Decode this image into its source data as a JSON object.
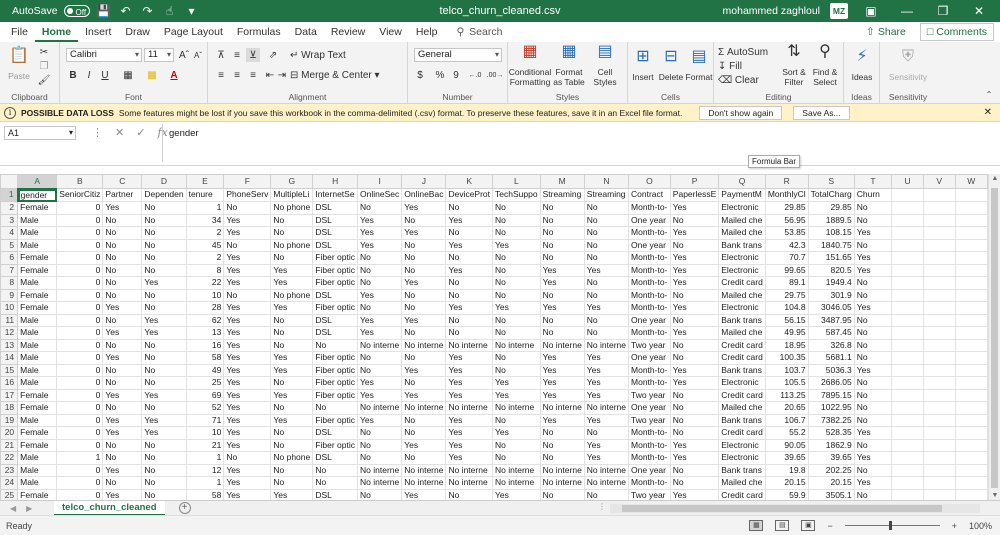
{
  "titlebar": {
    "autosave_label": "AutoSave",
    "autosave_state": "Off",
    "filename": "telco_churn_cleaned.csv",
    "user": "mohammed zaghloul",
    "avatar_initials": "MZ",
    "accent": "#217346"
  },
  "tabs": [
    "File",
    "Home",
    "Insert",
    "Draw",
    "Page Layout",
    "Formulas",
    "Data",
    "Review",
    "View",
    "Help"
  ],
  "active_tab": "Home",
  "search_label": "Search",
  "share_label": "Share",
  "comments_label": "Comments",
  "ribbon": {
    "clipboard": {
      "paste": "Paste",
      "label": "Clipboard"
    },
    "font": {
      "name": "Calibri",
      "size": "11",
      "label": "Font",
      "bold": "B",
      "italic": "I",
      "underline": "U"
    },
    "alignment": {
      "wrap": "Wrap Text",
      "merge": "Merge & Center",
      "label": "Alignment"
    },
    "number": {
      "format": "General",
      "currency": "$",
      "percent": "%",
      "comma": "9",
      "label": "Number"
    },
    "styles": {
      "conditional": "Conditional Formatting",
      "table": "Format as Table",
      "cell": "Cell Styles",
      "label": "Styles"
    },
    "cells": {
      "insert": "Insert",
      "delete": "Delete",
      "format": "Format",
      "label": "Cells"
    },
    "editing": {
      "autosum": "AutoSum",
      "fill": "Fill",
      "clear": "Clear",
      "sort": "Sort & Filter",
      "find": "Find & Select",
      "label": "Editing"
    },
    "ideas": {
      "ideas": "Ideas",
      "label": "Ideas"
    },
    "sensitivity": {
      "sensitivity": "Sensitivity",
      "label": "Sensitivity"
    }
  },
  "infobar": {
    "title": "POSSIBLE DATA LOSS",
    "message": "Some features might be lost if you save this workbook in the comma-delimited (.csv) format. To preserve these features, save it in an Excel file format.",
    "dont_show": "Don't show again",
    "save_as": "Save As..."
  },
  "formula_bar": {
    "name_box": "A1",
    "formula": "gender",
    "tooltip": "Formula Bar"
  },
  "columns": [
    "A",
    "B",
    "C",
    "D",
    "E",
    "F",
    "G",
    "H",
    "I",
    "J",
    "K",
    "L",
    "M",
    "N",
    "O",
    "P",
    "Q",
    "R",
    "S",
    "T",
    "U",
    "V",
    "W"
  ],
  "numeric_columns": [
    1,
    4,
    17,
    18
  ],
  "rows": [
    [
      "gender",
      "SeniorCitiz",
      "Partner",
      "Dependen",
      "tenure",
      "PhoneServ",
      "MultipleLi",
      "InternetSe",
      "OnlineSec",
      "OnlineBac",
      "DeviceProt",
      "TechSuppo",
      "Streaming",
      "Streaming",
      "Contract",
      "PaperlessE",
      "PaymentM",
      "MonthlyCl",
      "TotalCharg",
      "Churn"
    ],
    [
      "Female",
      "0",
      "Yes",
      "No",
      "1",
      "No",
      "No phone",
      "DSL",
      "No",
      "Yes",
      "No",
      "No",
      "No",
      "No",
      "Month-to-",
      "Yes",
      "Electronic",
      "29.85",
      "29.85",
      "No"
    ],
    [
      "Male",
      "0",
      "No",
      "No",
      "34",
      "Yes",
      "No",
      "DSL",
      "Yes",
      "No",
      "Yes",
      "No",
      "No",
      "No",
      "One year",
      "No",
      "Mailed che",
      "56.95",
      "1889.5",
      "No"
    ],
    [
      "Male",
      "0",
      "No",
      "No",
      "2",
      "Yes",
      "No",
      "DSL",
      "Yes",
      "Yes",
      "No",
      "No",
      "No",
      "No",
      "Month-to-",
      "Yes",
      "Mailed che",
      "53.85",
      "108.15",
      "Yes"
    ],
    [
      "Male",
      "0",
      "No",
      "No",
      "45",
      "No",
      "No phone",
      "DSL",
      "Yes",
      "No",
      "Yes",
      "Yes",
      "No",
      "No",
      "One year",
      "No",
      "Bank trans",
      "42.3",
      "1840.75",
      "No"
    ],
    [
      "Female",
      "0",
      "No",
      "No",
      "2",
      "Yes",
      "No",
      "Fiber optic",
      "No",
      "No",
      "No",
      "No",
      "No",
      "No",
      "Month-to-",
      "Yes",
      "Electronic",
      "70.7",
      "151.65",
      "Yes"
    ],
    [
      "Female",
      "0",
      "No",
      "No",
      "8",
      "Yes",
      "Yes",
      "Fiber optic",
      "No",
      "No",
      "Yes",
      "No",
      "Yes",
      "Yes",
      "Month-to-",
      "Yes",
      "Electronic",
      "99.65",
      "820.5",
      "Yes"
    ],
    [
      "Male",
      "0",
      "No",
      "Yes",
      "22",
      "Yes",
      "Yes",
      "Fiber optic",
      "No",
      "Yes",
      "No",
      "No",
      "Yes",
      "No",
      "Month-to-",
      "Yes",
      "Credit card",
      "89.1",
      "1949.4",
      "No"
    ],
    [
      "Female",
      "0",
      "No",
      "No",
      "10",
      "No",
      "No phone",
      "DSL",
      "Yes",
      "No",
      "No",
      "No",
      "No",
      "No",
      "Month-to-",
      "No",
      "Mailed che",
      "29.75",
      "301.9",
      "No"
    ],
    [
      "Female",
      "0",
      "Yes",
      "No",
      "28",
      "Yes",
      "Yes",
      "Fiber optic",
      "No",
      "No",
      "Yes",
      "Yes",
      "Yes",
      "Yes",
      "Month-to-",
      "Yes",
      "Electronic",
      "104.8",
      "3046.05",
      "Yes"
    ],
    [
      "Male",
      "0",
      "No",
      "Yes",
      "62",
      "Yes",
      "No",
      "DSL",
      "Yes",
      "Yes",
      "No",
      "No",
      "No",
      "No",
      "One year",
      "No",
      "Bank trans",
      "56.15",
      "3487.95",
      "No"
    ],
    [
      "Male",
      "0",
      "Yes",
      "Yes",
      "13",
      "Yes",
      "No",
      "DSL",
      "Yes",
      "No",
      "No",
      "No",
      "No",
      "No",
      "Month-to-",
      "Yes",
      "Mailed che",
      "49.95",
      "587.45",
      "No"
    ],
    [
      "Male",
      "0",
      "No",
      "No",
      "16",
      "Yes",
      "No",
      "No",
      "No interne",
      "No interne",
      "No interne",
      "No interne",
      "No interne",
      "No interne",
      "Two year",
      "No",
      "Credit card",
      "18.95",
      "326.8",
      "No"
    ],
    [
      "Male",
      "0",
      "Yes",
      "No",
      "58",
      "Yes",
      "Yes",
      "Fiber optic",
      "No",
      "No",
      "Yes",
      "No",
      "Yes",
      "Yes",
      "One year",
      "No",
      "Credit card",
      "100.35",
      "5681.1",
      "No"
    ],
    [
      "Male",
      "0",
      "No",
      "No",
      "49",
      "Yes",
      "Yes",
      "Fiber optic",
      "No",
      "Yes",
      "Yes",
      "No",
      "Yes",
      "Yes",
      "Month-to-",
      "Yes",
      "Bank trans",
      "103.7",
      "5036.3",
      "Yes"
    ],
    [
      "Male",
      "0",
      "No",
      "No",
      "25",
      "Yes",
      "No",
      "Fiber optic",
      "Yes",
      "No",
      "Yes",
      "Yes",
      "Yes",
      "Yes",
      "Month-to-",
      "Yes",
      "Electronic",
      "105.5",
      "2686.05",
      "No"
    ],
    [
      "Female",
      "0",
      "Yes",
      "Yes",
      "69",
      "Yes",
      "Yes",
      "Fiber optic",
      "Yes",
      "Yes",
      "Yes",
      "Yes",
      "Yes",
      "Yes",
      "Two year",
      "No",
      "Credit card",
      "113.25",
      "7895.15",
      "No"
    ],
    [
      "Female",
      "0",
      "No",
      "No",
      "52",
      "Yes",
      "No",
      "No",
      "No interne",
      "No interne",
      "No interne",
      "No interne",
      "No interne",
      "No interne",
      "One year",
      "No",
      "Mailed che",
      "20.65",
      "1022.95",
      "No"
    ],
    [
      "Male",
      "0",
      "Yes",
      "Yes",
      "71",
      "Yes",
      "Yes",
      "Fiber optic",
      "Yes",
      "No",
      "Yes",
      "No",
      "Yes",
      "Yes",
      "Two year",
      "No",
      "Bank trans",
      "106.7",
      "7382.25",
      "No"
    ],
    [
      "Female",
      "0",
      "Yes",
      "Yes",
      "10",
      "Yes",
      "No",
      "DSL",
      "No",
      "No",
      "Yes",
      "Yes",
      "No",
      "No",
      "Month-to-",
      "No",
      "Credit card",
      "55.2",
      "528.35",
      "Yes"
    ],
    [
      "Female",
      "0",
      "No",
      "No",
      "21",
      "Yes",
      "No",
      "Fiber optic",
      "No",
      "Yes",
      "Yes",
      "No",
      "No",
      "Yes",
      "Month-to-",
      "Yes",
      "Electronic",
      "90.05",
      "1862.9",
      "No"
    ],
    [
      "Male",
      "1",
      "No",
      "No",
      "1",
      "No",
      "No phone",
      "DSL",
      "No",
      "No",
      "Yes",
      "No",
      "No",
      "Yes",
      "Month-to-",
      "Yes",
      "Electronic",
      "39.65",
      "39.65",
      "Yes"
    ],
    [
      "Male",
      "0",
      "Yes",
      "No",
      "12",
      "Yes",
      "No",
      "No",
      "No interne",
      "No interne",
      "No interne",
      "No interne",
      "No interne",
      "No interne",
      "One year",
      "No",
      "Bank trans",
      "19.8",
      "202.25",
      "No"
    ],
    [
      "Male",
      "0",
      "No",
      "No",
      "1",
      "Yes",
      "No",
      "No",
      "No interne",
      "No interne",
      "No interne",
      "No interne",
      "No interne",
      "No interne",
      "Month-to-",
      "No",
      "Mailed che",
      "20.15",
      "20.15",
      "Yes"
    ],
    [
      "Female",
      "0",
      "Yes",
      "No",
      "58",
      "Yes",
      "Yes",
      "DSL",
      "No",
      "Yes",
      "No",
      "Yes",
      "No",
      "No",
      "Two year",
      "Yes",
      "Credit card",
      "59.9",
      "3505.1",
      "No"
    ]
  ],
  "sheet_tab": "telco_churn_cleaned",
  "status": {
    "ready": "Ready",
    "zoom": "100%"
  }
}
